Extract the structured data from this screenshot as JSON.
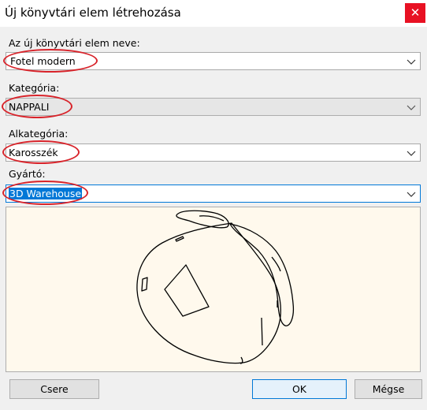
{
  "window": {
    "title": "Új könyvtári elem létrehozása",
    "close_glyph": "✕"
  },
  "fields": {
    "name": {
      "label": "Az új könyvtári elem neve:",
      "value": "Fotel modern"
    },
    "category": {
      "label": "Kategória:",
      "value": "NAPPALI"
    },
    "subcategory": {
      "label": "Alkategória:",
      "value": "Karosszék"
    },
    "manufacturer": {
      "label": "Gyártó:",
      "value": "3D Warehouse"
    }
  },
  "buttons": {
    "replace": "Csere",
    "ok": "OK",
    "cancel": "Mégse"
  },
  "colors": {
    "highlight": "#d8232a",
    "selection": "#0078d7",
    "preview_bg": "#fff9ed"
  }
}
